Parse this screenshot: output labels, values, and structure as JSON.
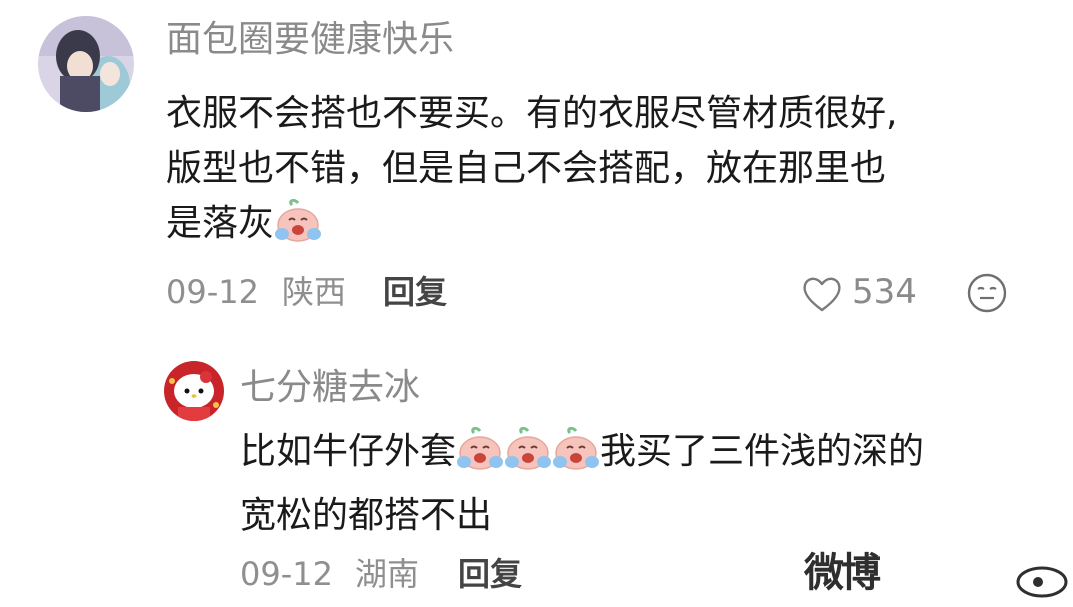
{
  "comment": {
    "username": "面包圈要健康快乐",
    "text_line1": "衣服不会搭也不要买。有的衣服尽管材质很好,",
    "text_line2": "版型也不错，但是自己不会搭配，放在那里也",
    "text_line3": "是落灰",
    "date": "09-12",
    "location": "陕西",
    "reply_label": "回复",
    "like_count": "534"
  },
  "reply_comment": {
    "username": "七分糖去冰",
    "text_line1_a": "比如牛仔外套",
    "text_line1_b": "我买了三件浅的深的",
    "text_line2": "宽松的都搭不出",
    "date": "09-12",
    "location": "湖南",
    "reply_label": "回复"
  },
  "watermark": {
    "text": "微博"
  },
  "colors": {
    "emoji_face": "#f6c4bc",
    "emoji_leaf": "#7cc08a",
    "tear": "#8fc4f0"
  }
}
